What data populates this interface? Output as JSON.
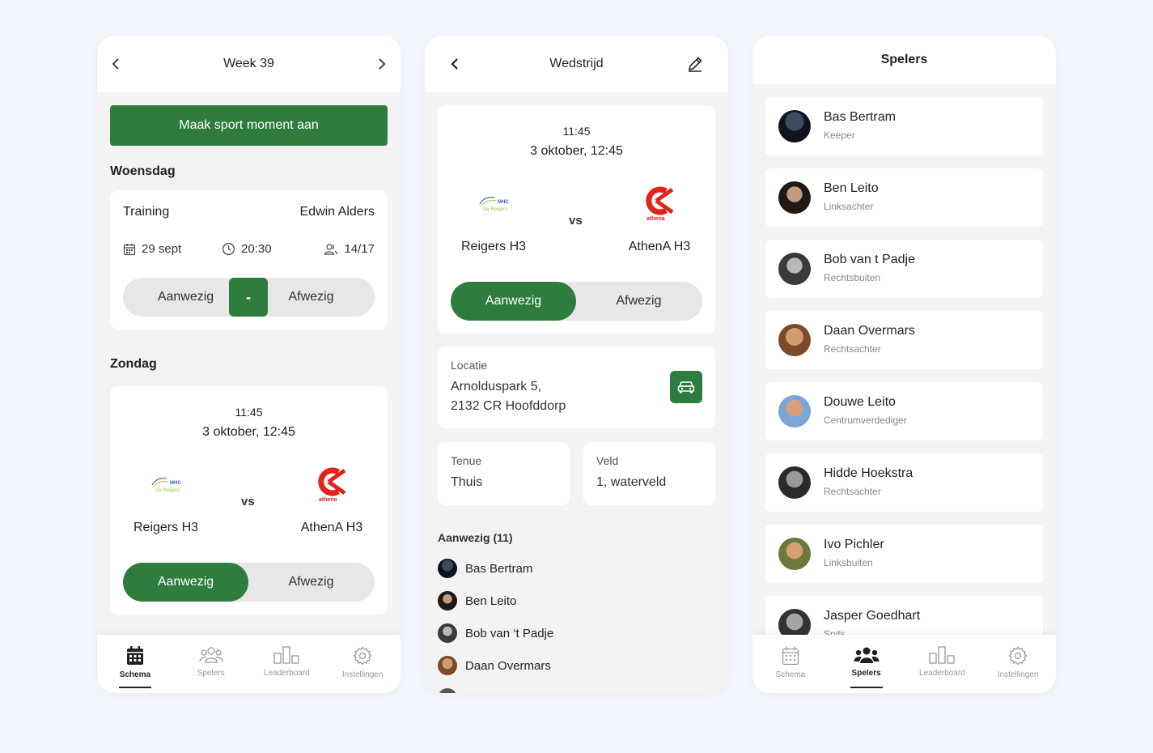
{
  "schedule": {
    "header": {
      "title": "Week 39"
    },
    "create_button": "Maak sport moment aan",
    "day1": {
      "label": "Woensdag",
      "type": "Training",
      "trainer": "Edwin Alders",
      "date": "29 sept",
      "time": "20:30",
      "attendance": "14/17",
      "toggle": {
        "present": "Aanwezig",
        "middle": "-",
        "absent": "Afwezig"
      }
    },
    "day2": {
      "label": "Zondag",
      "time": "11:45",
      "date": "3 oktober, 12:45",
      "home_team": "Reigers H3",
      "away_team": "AthenA H3",
      "vs": "vs",
      "home_logo_text": "MHC De Reigers",
      "away_logo_text": "athena",
      "toggle": {
        "present": "Aanwezig",
        "absent": "Afwezig"
      }
    },
    "tabs": [
      "Schema",
      "Spelers",
      "Leaderboard",
      "Instellingen"
    ],
    "active_tab": "Schema"
  },
  "match": {
    "header": {
      "title": "Wedstrijd"
    },
    "time": "11:45",
    "date": "3 oktober, 12:45",
    "home_team": "Reigers H3",
    "away_team": "AthenA H3",
    "vs": "vs",
    "home_logo_text": "MHC De Reigers",
    "away_logo_text": "athena",
    "toggle": {
      "present": "Aanwezig",
      "absent": "Afwezig"
    },
    "location": {
      "label": "Locatie",
      "line1": "Arnolduspark 5,",
      "line2": "2132 CR Hoofddorp"
    },
    "kit": {
      "label": "Tenue",
      "value": "Thuis"
    },
    "field": {
      "label": "Veld",
      "value": "1, waterveld"
    },
    "present_heading": "Aanwezig (11)",
    "present_list": [
      "Bas Bertram",
      "Ben Leito",
      "Bob van ‘t Padje",
      "Daan Overmars"
    ]
  },
  "players": {
    "header": {
      "title": "Spelers"
    },
    "list": [
      {
        "name": "Bas Bertram",
        "role": "Keeper"
      },
      {
        "name": "Ben Leito",
        "role": "Linksachter"
      },
      {
        "name": "Bob van t Padje",
        "role": "Rechtsbuiten"
      },
      {
        "name": "Daan Overmars",
        "role": "Rechtsachter"
      },
      {
        "name": "Douwe Leito",
        "role": "Centrumverdediger"
      },
      {
        "name": "Hidde Hoekstra",
        "role": "Rechtsachter"
      },
      {
        "name": "Ivo Pichler",
        "role": "Linksbuiten"
      },
      {
        "name": "Jasper Goedhart",
        "role": "Spits"
      }
    ],
    "tabs": [
      "Schema",
      "Spelers",
      "Leaderboard",
      "Instellingen"
    ],
    "active_tab": "Spelers"
  },
  "colors": {
    "accent": "#2e7d3e",
    "background": "#f2f5fb",
    "panel": "#f3f3f3",
    "athena_red": "#e2231a"
  }
}
